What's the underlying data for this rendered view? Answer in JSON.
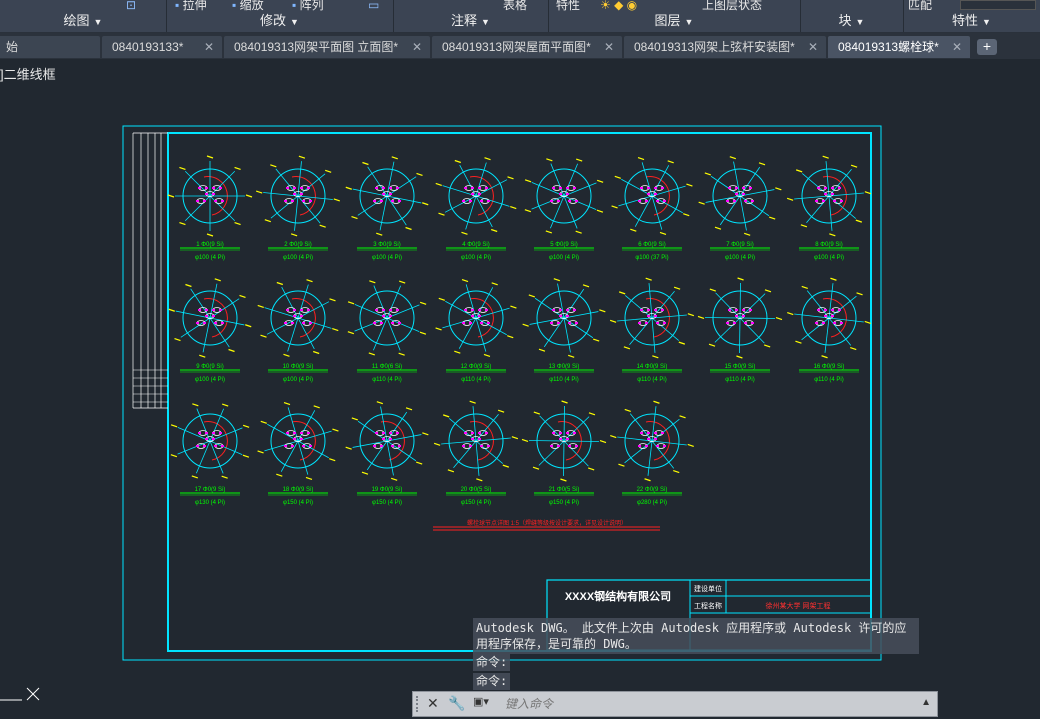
{
  "ribbon": {
    "panels": [
      {
        "label": "绘图",
        "name": "panel-draw"
      },
      {
        "label": "修改",
        "name": "panel-modify"
      },
      {
        "label": "注释",
        "name": "panel-annotate"
      },
      {
        "label": "图层",
        "name": "panel-layers"
      },
      {
        "label": "块",
        "name": "panel-block"
      },
      {
        "label": "特性",
        "name": "panel-properties"
      }
    ],
    "top_partial": {
      "stretch": "拉伸",
      "scale": "缩放",
      "array": "阵列",
      "table": "表格",
      "properties": "特性",
      "layer_state": "上图层状态",
      "match": "匹配"
    }
  },
  "tabs": [
    {
      "label": "始",
      "active": false,
      "closable": false
    },
    {
      "label": "0840193133*",
      "active": false,
      "closable": true
    },
    {
      "label": "084019313网架平面图 立面图*",
      "active": false,
      "closable": true
    },
    {
      "label": "084019313网架屋面平面图*",
      "active": false,
      "closable": true
    },
    {
      "label": "084019313网架上弦杆安装图*",
      "active": false,
      "closable": true
    },
    {
      "label": "084019313螺栓球*",
      "active": true,
      "closable": true
    }
  ],
  "tab_add": "+",
  "viewport_label": "]二维线框",
  "drawing": {
    "rows": [
      {
        "balls": [
          "1 Φ0(9 Si)",
          "2 Φ0(9 Si)",
          "3 Φ0(9 Si)",
          "4 Φ0(9 Si)",
          "5 Φ0(9 Si)",
          "6 Φ0(9 Si)",
          "7 Φ0(9 Si)",
          "8 Φ0(9 Si)"
        ],
        "specs": [
          "φ100 (4 Pi)",
          "φ100 (4 Pi)",
          "φ100 (4 Pi)",
          "φ100 (4 Pi)",
          "φ100 (4 Pi)",
          "φ100 (37 Pi)",
          "φ100 (4 Pi)",
          "φ100 (4 Pi)"
        ]
      },
      {
        "balls": [
          "9 Φ0(9 Si)",
          "10 Φ0(9 Si)",
          "11 Φ0(6 Si)",
          "12 Φ0(9 Si)",
          "13 Φ0(9 Si)",
          "14 Φ0(9 Si)",
          "15 Φ0(9 Si)",
          "16 Φ0(9 Si)"
        ],
        "specs": [
          "φ100 (4 Pi)",
          "φ100 (4 Pi)",
          "φ110 (4 Pi)",
          "φ110 (4 Pi)",
          "φ110 (4 Pi)",
          "φ110 (4 Pi)",
          "φ110 (4 Pi)",
          "φ110 (4 Pi)"
        ]
      },
      {
        "balls": [
          "17 Φ0(9 Si)",
          "18 Φ0(9 Si)",
          "19 Φ0(9 Si)",
          "20 Φ0(5 Si)",
          "21 Φ0(5 Si)",
          "22 Φ0(9 Si)"
        ],
        "specs": [
          "φ130 (4 Pi)",
          "φ150 (4 Pi)",
          "φ150 (4 Pi)",
          "φ150 (4 Pi)",
          "φ150 (4 Pi)",
          "φ280 (4 Pi)"
        ]
      }
    ],
    "note": "螺栓球节点详图 1:5（焊缝等级按设计要求，详见设计说明）",
    "title_block": {
      "company": "XXXX钢结构有限公司",
      "owner_label": "建设单位",
      "project_label": "工程名称",
      "project_value": "徐州某大学 网架工程"
    }
  },
  "command": {
    "history_line1": "Autodesk DWG。  此文件上次由 Autodesk 应用程序或 Autodesk 许可的应",
    "history_line2": "用程序保存，是可靠的 DWG。",
    "prompt1": "命令:",
    "prompt2": "命令:",
    "placeholder": "键入命令"
  },
  "colors": {
    "background": "#212830",
    "frame": "#00e5ff",
    "text_green": "#00ff00",
    "bolt_magenta": "#ff00ff",
    "annotation_yellow": "#ffff00",
    "red_arc": "#ff2020",
    "title_red": "#ff3030"
  }
}
